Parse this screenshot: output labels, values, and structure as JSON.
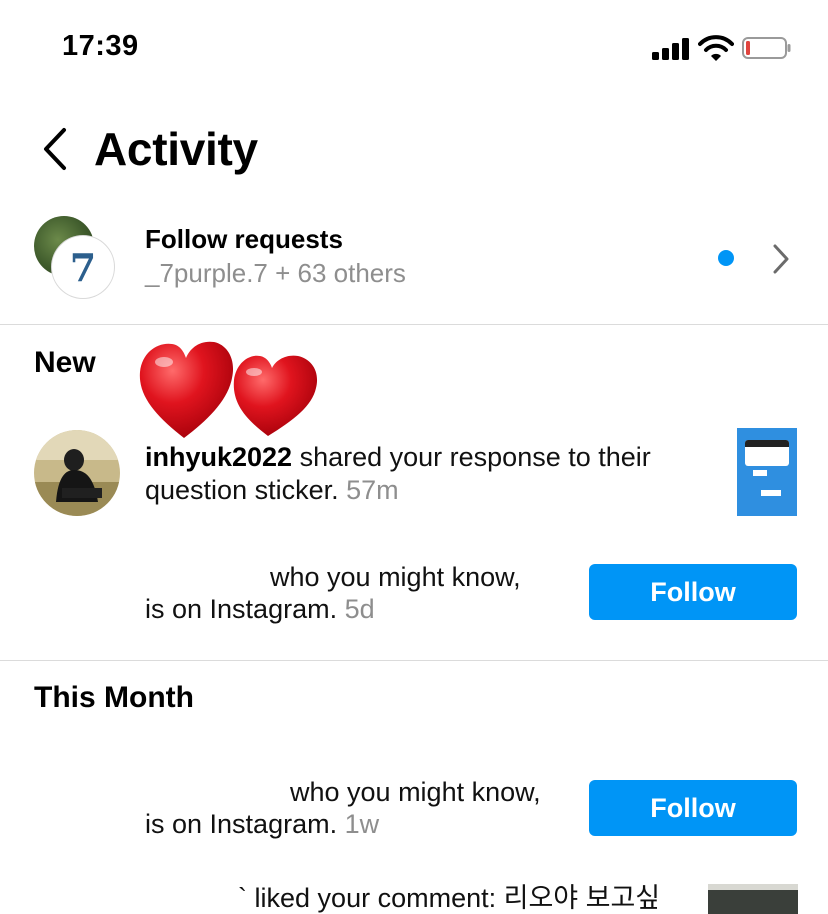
{
  "status_bar": {
    "time": "17:39",
    "icons": [
      "cellular-signal-icon",
      "wifi-icon",
      "battery-low-icon"
    ],
    "battery_color": "#e0443e"
  },
  "header": {
    "back_icon": "chevron-left-icon",
    "title": "Activity"
  },
  "follow_requests": {
    "title": "Follow requests",
    "subtitle": "_7purple.7 + 63 others",
    "avatar_badge": "7",
    "unread_dot_color": "#0095f6",
    "chevron_icon": "chevron-right-icon"
  },
  "sections": {
    "new": "New",
    "this_month": "This Month"
  },
  "decoration": {
    "icon": "heart-emoji-icon",
    "color": "#e0141e"
  },
  "notifications": {
    "shared": {
      "username": "inhyuk2022",
      "text": " shared your response to their question sticker.",
      "time": "57m"
    },
    "suggest_1": {
      "line1": "who you might know,",
      "line2": "is on Instagram.",
      "time": "5d",
      "button": "Follow"
    },
    "suggest_2": {
      "line1": "who you might know,",
      "line2": "is on Instagram.",
      "time": "1w",
      "button": "Follow"
    },
    "liked": {
      "prefix": "`",
      "text": "liked your comment: 리오야 보고싶"
    }
  },
  "colors": {
    "accent": "#0095f6",
    "secondary_text": "#8e8e8e",
    "divider": "#dbdbdb"
  }
}
